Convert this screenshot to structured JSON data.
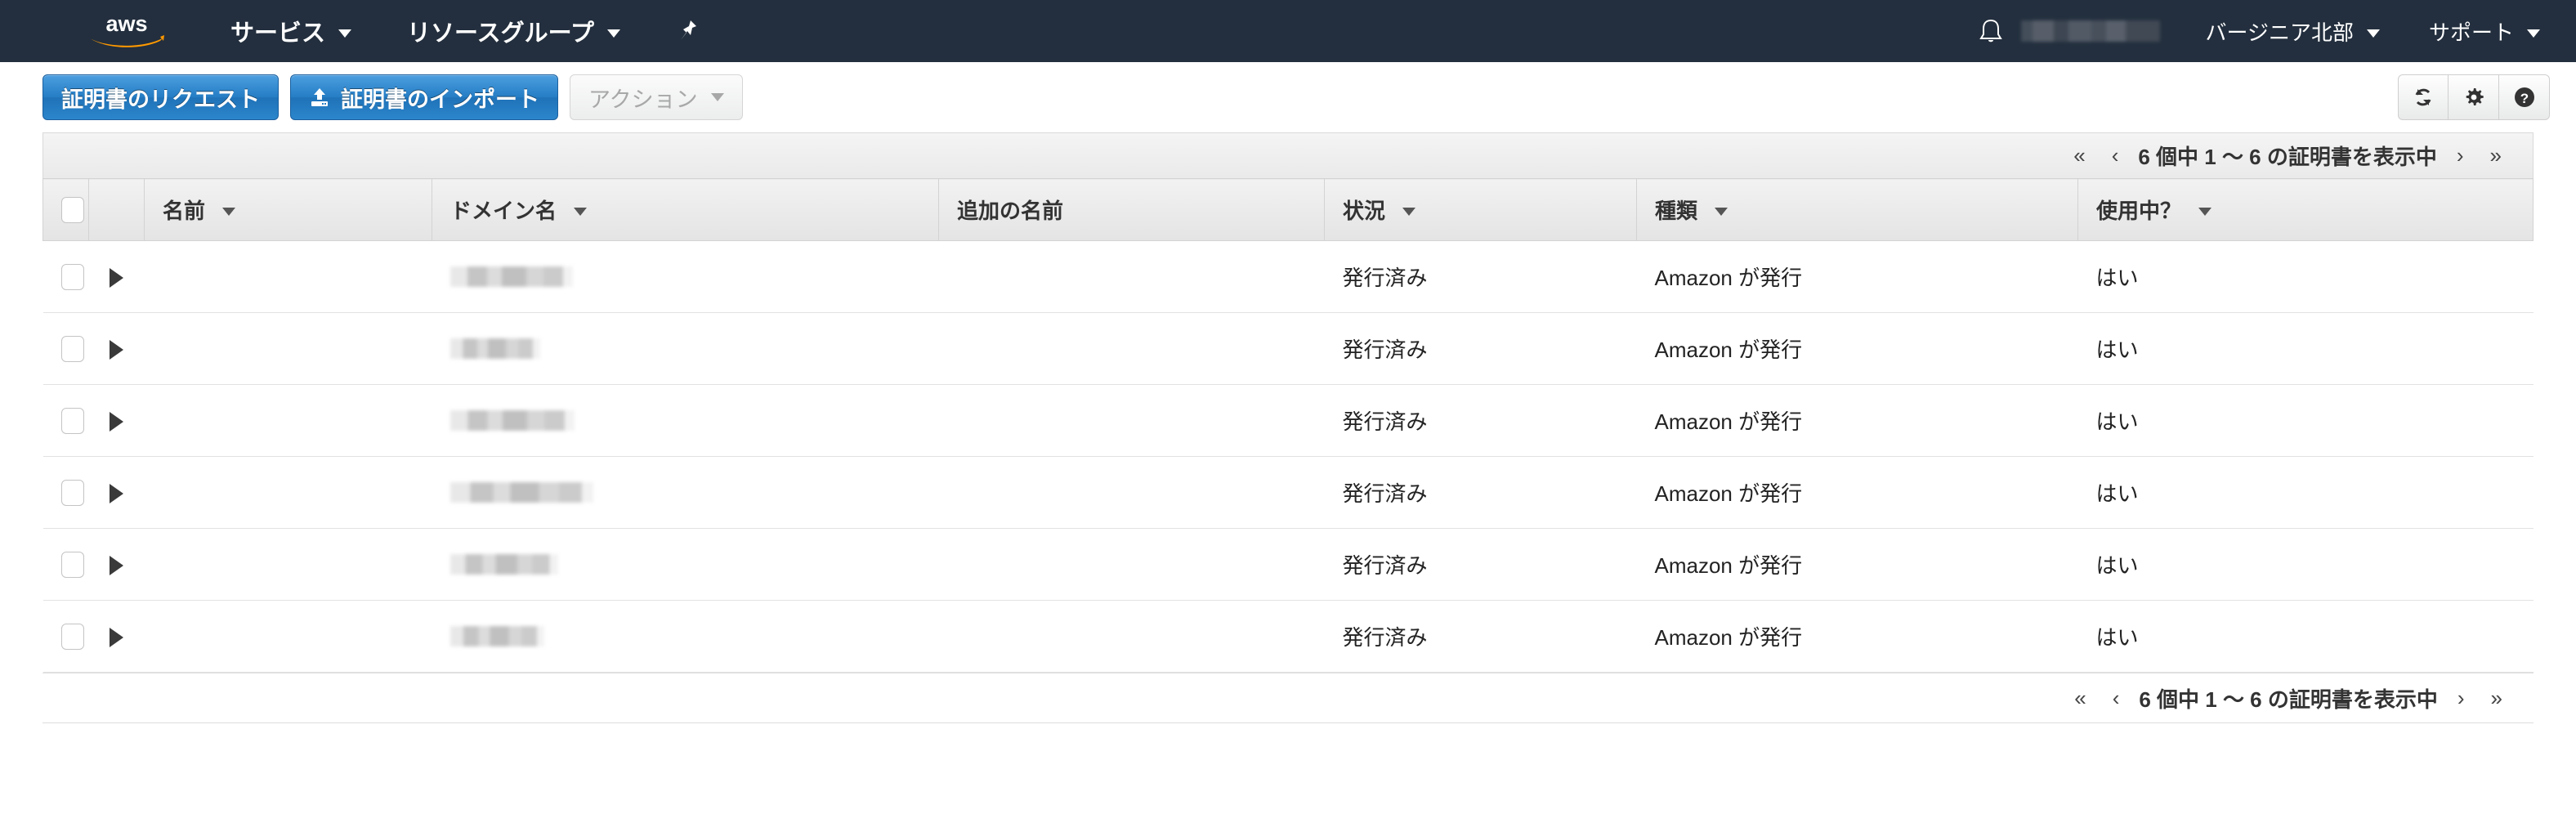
{
  "nav": {
    "logo_alt": "aws",
    "items": [
      {
        "label": "サービス",
        "has_caret": true
      },
      {
        "label": "リソースグループ",
        "has_caret": true
      }
    ],
    "pin_icon": "pushpin-icon",
    "bell_icon": "bell-icon",
    "account_redacted": "",
    "region": "バージニア北部",
    "support": "サポート"
  },
  "toolbar": {
    "request_certificate": "証明書のリクエスト",
    "import_certificate": "証明書のインポート",
    "actions": "アクション",
    "refresh_icon": "refresh-icon",
    "settings_icon": "gear-icon",
    "help_icon": "help-icon"
  },
  "pagination": {
    "first": "«",
    "prev": "‹",
    "label": "6 個中 1 〜 6 の証明書を表示中",
    "next": "›",
    "last": "»"
  },
  "table": {
    "columns": [
      {
        "label": "",
        "sortable": false
      },
      {
        "label": "",
        "sortable": false
      },
      {
        "label": "名前",
        "sortable": true
      },
      {
        "label": "ドメイン名",
        "sortable": true
      },
      {
        "label": "追加の名前",
        "sortable": false
      },
      {
        "label": "状況",
        "sortable": true
      },
      {
        "label": "種類",
        "sortable": true
      },
      {
        "label": "使用中？",
        "sortable": true
      }
    ],
    "rows": [
      {
        "name": "",
        "domain": "",
        "domain_width": 150,
        "additional": "",
        "status": "発行済み",
        "type": "Amazon が発行",
        "in_use": "はい"
      },
      {
        "name": "",
        "domain": "",
        "domain_width": 110,
        "additional": "",
        "status": "発行済み",
        "type": "Amazon が発行",
        "in_use": "はい"
      },
      {
        "name": "",
        "domain": "",
        "domain_width": 152,
        "additional": "",
        "status": "発行済み",
        "type": "Amazon が発行",
        "in_use": "はい"
      },
      {
        "name": "",
        "domain": "",
        "domain_width": 175,
        "additional": "",
        "status": "発行済み",
        "type": "Amazon が発行",
        "in_use": "はい"
      },
      {
        "name": "",
        "domain": "",
        "domain_width": 132,
        "additional": "",
        "status": "発行済み",
        "type": "Amazon が発行",
        "in_use": "はい"
      },
      {
        "name": "",
        "domain": "",
        "domain_width": 115,
        "additional": "",
        "status": "発行済み",
        "type": "Amazon が発行",
        "in_use": "はい"
      }
    ]
  },
  "colors": {
    "nav_bg": "#232f3e",
    "primary_button": "#257dc4",
    "status_issued": "#1d8102",
    "logo_accent": "#ff9900"
  }
}
